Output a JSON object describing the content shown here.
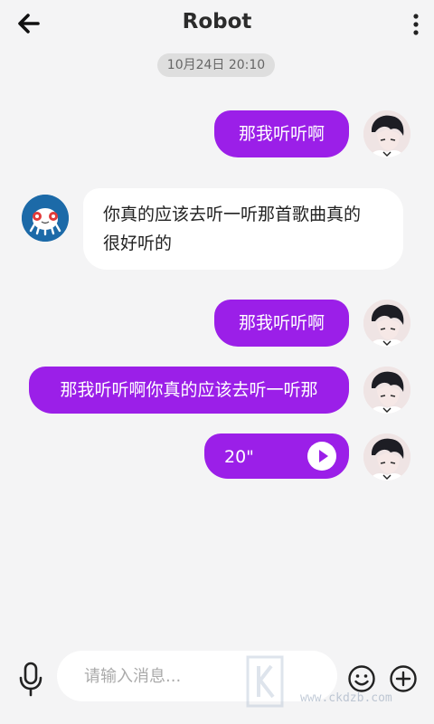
{
  "header": {
    "title": "Robot"
  },
  "timestamp": "10月24日 20:10",
  "messages": {
    "m1": {
      "direction": "outgoing",
      "text": "那我听听啊"
    },
    "m2_line1": "你真的应该去听一听那首歌曲真的",
    "m2_line2": "很好听的",
    "m3": {
      "direction": "outgoing",
      "text": "那我听听啊"
    },
    "m4": {
      "direction": "outgoing",
      "text": "那我听听啊你真的应该去听一听那"
    },
    "m5": {
      "direction": "outgoing",
      "type": "voice",
      "duration": "20\""
    }
  },
  "composer": {
    "placeholder": "请输入消息..."
  },
  "watermark": {
    "text": "www.ckdzb.com"
  },
  "colors": {
    "accent": "#9b1fe8",
    "background": "#f4f4f5",
    "incoming_bubble": "#ffffff"
  },
  "icons": {
    "back": "arrow-left-icon",
    "more": "more-vertical-icon",
    "mic": "microphone-icon",
    "emoji": "smiley-icon",
    "plus": "plus-circle-icon",
    "play": "play-icon"
  }
}
